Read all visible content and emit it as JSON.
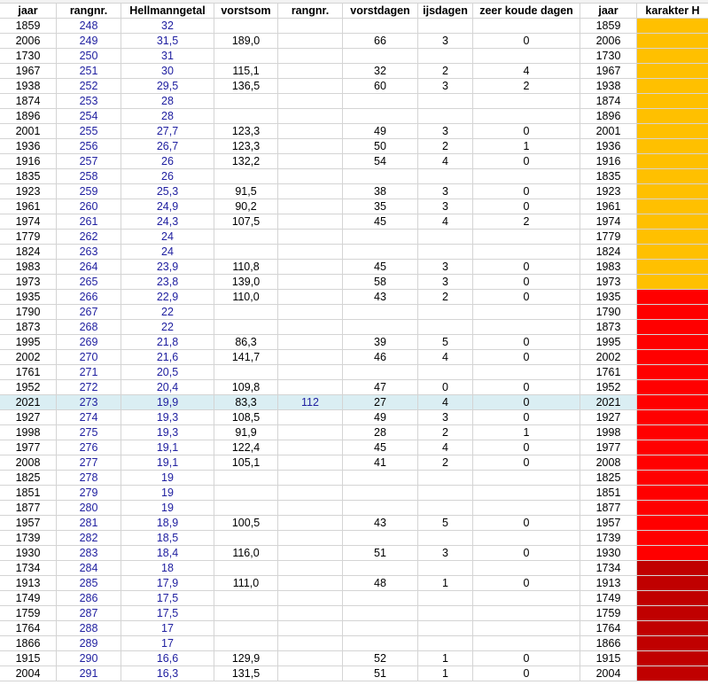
{
  "colors": {
    "orange": "#ffc000",
    "red": "#ff0000",
    "darkred": "#c00000",
    "highlight_row": "#daeef3",
    "number_blue": "#2020a0"
  },
  "headers": [
    "jaar",
    "rangnr.",
    "Hellmanngetal",
    "vorstsom",
    "rangnr.",
    "vorstdagen",
    "ijsdagen",
    "zeer koude dagen",
    "jaar",
    "karakter H"
  ],
  "rows": [
    {
      "c": [
        "1859",
        "248",
        "32",
        "",
        "",
        "",
        "",
        "",
        "1859",
        ""
      ],
      "color": "orange"
    },
    {
      "c": [
        "2006",
        "249",
        "31,5",
        "189,0",
        "",
        "66",
        "3",
        "0",
        "2006",
        ""
      ],
      "color": "orange"
    },
    {
      "c": [
        "1730",
        "250",
        "31",
        "",
        "",
        "",
        "",
        "",
        "1730",
        ""
      ],
      "color": "orange"
    },
    {
      "c": [
        "1967",
        "251",
        "30",
        "115,1",
        "",
        "32",
        "2",
        "4",
        "1967",
        ""
      ],
      "color": "orange"
    },
    {
      "c": [
        "1938",
        "252",
        "29,5",
        "136,5",
        "",
        "60",
        "3",
        "2",
        "1938",
        ""
      ],
      "color": "orange"
    },
    {
      "c": [
        "1874",
        "253",
        "28",
        "",
        "",
        "",
        "",
        "",
        "1874",
        ""
      ],
      "color": "orange"
    },
    {
      "c": [
        "1896",
        "254",
        "28",
        "",
        "",
        "",
        "",
        "",
        "1896",
        ""
      ],
      "color": "orange"
    },
    {
      "c": [
        "2001",
        "255",
        "27,7",
        "123,3",
        "",
        "49",
        "3",
        "0",
        "2001",
        ""
      ],
      "color": "orange"
    },
    {
      "c": [
        "1936",
        "256",
        "26,7",
        "123,3",
        "",
        "50",
        "2",
        "1",
        "1936",
        ""
      ],
      "color": "orange"
    },
    {
      "c": [
        "1916",
        "257",
        "26",
        "132,2",
        "",
        "54",
        "4",
        "0",
        "1916",
        ""
      ],
      "color": "orange"
    },
    {
      "c": [
        "1835",
        "258",
        "26",
        "",
        "",
        "",
        "",
        "",
        "1835",
        ""
      ],
      "color": "orange"
    },
    {
      "c": [
        "1923",
        "259",
        "25,3",
        "91,5",
        "",
        "38",
        "3",
        "0",
        "1923",
        ""
      ],
      "color": "orange"
    },
    {
      "c": [
        "1961",
        "260",
        "24,9",
        "90,2",
        "",
        "35",
        "3",
        "0",
        "1961",
        ""
      ],
      "color": "orange"
    },
    {
      "c": [
        "1974",
        "261",
        "24,3",
        "107,5",
        "",
        "45",
        "4",
        "2",
        "1974",
        ""
      ],
      "color": "orange"
    },
    {
      "c": [
        "1779",
        "262",
        "24",
        "",
        "",
        "",
        "",
        "",
        "1779",
        ""
      ],
      "color": "orange"
    },
    {
      "c": [
        "1824",
        "263",
        "24",
        "",
        "",
        "",
        "",
        "",
        "1824",
        ""
      ],
      "color": "orange"
    },
    {
      "c": [
        "1983",
        "264",
        "23,9",
        "110,8",
        "",
        "45",
        "3",
        "0",
        "1983",
        ""
      ],
      "color": "orange"
    },
    {
      "c": [
        "1973",
        "265",
        "23,8",
        "139,0",
        "",
        "58",
        "3",
        "0",
        "1973",
        ""
      ],
      "color": "orange"
    },
    {
      "c": [
        "1935",
        "266",
        "22,9",
        "110,0",
        "",
        "43",
        "2",
        "0",
        "1935",
        ""
      ],
      "color": "red"
    },
    {
      "c": [
        "1790",
        "267",
        "22",
        "",
        "",
        "",
        "",
        "",
        "1790",
        ""
      ],
      "color": "red"
    },
    {
      "c": [
        "1873",
        "268",
        "22",
        "",
        "",
        "",
        "",
        "",
        "1873",
        ""
      ],
      "color": "red"
    },
    {
      "c": [
        "1995",
        "269",
        "21,8",
        "86,3",
        "",
        "39",
        "5",
        "0",
        "1995",
        ""
      ],
      "color": "red"
    },
    {
      "c": [
        "2002",
        "270",
        "21,6",
        "141,7",
        "",
        "46",
        "4",
        "0",
        "2002",
        ""
      ],
      "color": "red"
    },
    {
      "c": [
        "1761",
        "271",
        "20,5",
        "",
        "",
        "",
        "",
        "",
        "1761",
        ""
      ],
      "color": "red"
    },
    {
      "c": [
        "1952",
        "272",
        "20,4",
        "109,8",
        "",
        "47",
        "0",
        "0",
        "1952",
        ""
      ],
      "color": "red"
    },
    {
      "c": [
        "2021",
        "273",
        "19,9",
        "83,3",
        "112",
        "27",
        "4",
        "0",
        "2021",
        ""
      ],
      "color": "red",
      "highlight": true
    },
    {
      "c": [
        "1927",
        "274",
        "19,3",
        "108,5",
        "",
        "49",
        "3",
        "0",
        "1927",
        ""
      ],
      "color": "red"
    },
    {
      "c": [
        "1998",
        "275",
        "19,3",
        "91,9",
        "",
        "28",
        "2",
        "1",
        "1998",
        ""
      ],
      "color": "red"
    },
    {
      "c": [
        "1977",
        "276",
        "19,1",
        "122,4",
        "",
        "45",
        "4",
        "0",
        "1977",
        ""
      ],
      "color": "red"
    },
    {
      "c": [
        "2008",
        "277",
        "19,1",
        "105,1",
        "",
        "41",
        "2",
        "0",
        "2008",
        ""
      ],
      "color": "red"
    },
    {
      "c": [
        "1825",
        "278",
        "19",
        "",
        "",
        "",
        "",
        "",
        "1825",
        ""
      ],
      "color": "red"
    },
    {
      "c": [
        "1851",
        "279",
        "19",
        "",
        "",
        "",
        "",
        "",
        "1851",
        ""
      ],
      "color": "red"
    },
    {
      "c": [
        "1877",
        "280",
        "19",
        "",
        "",
        "",
        "",
        "",
        "1877",
        ""
      ],
      "color": "red"
    },
    {
      "c": [
        "1957",
        "281",
        "18,9",
        "100,5",
        "",
        "43",
        "5",
        "0",
        "1957",
        ""
      ],
      "color": "red"
    },
    {
      "c": [
        "1739",
        "282",
        "18,5",
        "",
        "",
        "",
        "",
        "",
        "1739",
        ""
      ],
      "color": "red"
    },
    {
      "c": [
        "1930",
        "283",
        "18,4",
        "116,0",
        "",
        "51",
        "3",
        "0",
        "1930",
        ""
      ],
      "color": "red"
    },
    {
      "c": [
        "1734",
        "284",
        "18",
        "",
        "",
        "",
        "",
        "",
        "1734",
        ""
      ],
      "color": "darkred"
    },
    {
      "c": [
        "1913",
        "285",
        "17,9",
        "111,0",
        "",
        "48",
        "1",
        "0",
        "1913",
        ""
      ],
      "color": "darkred"
    },
    {
      "c": [
        "1749",
        "286",
        "17,5",
        "",
        "",
        "",
        "",
        "",
        "1749",
        ""
      ],
      "color": "darkred"
    },
    {
      "c": [
        "1759",
        "287",
        "17,5",
        "",
        "",
        "",
        "",
        "",
        "1759",
        ""
      ],
      "color": "darkred"
    },
    {
      "c": [
        "1764",
        "288",
        "17",
        "",
        "",
        "",
        "",
        "",
        "1764",
        ""
      ],
      "color": "darkred"
    },
    {
      "c": [
        "1866",
        "289",
        "17",
        "",
        "",
        "",
        "",
        "",
        "1866",
        ""
      ],
      "color": "darkred"
    },
    {
      "c": [
        "1915",
        "290",
        "16,6",
        "129,9",
        "",
        "52",
        "1",
        "0",
        "1915",
        ""
      ],
      "color": "darkred"
    },
    {
      "c": [
        "2004",
        "291",
        "16,3",
        "131,5",
        "",
        "51",
        "1",
        "0",
        "2004",
        ""
      ],
      "color": "darkred"
    }
  ]
}
